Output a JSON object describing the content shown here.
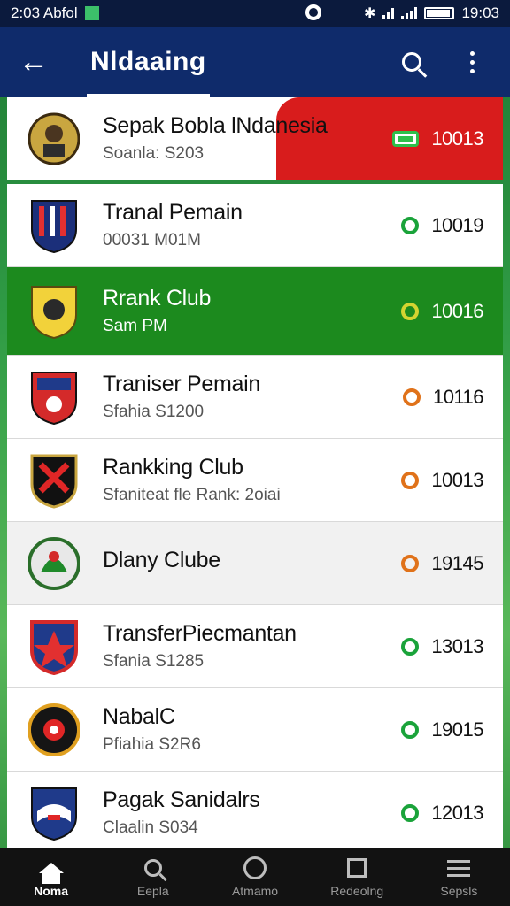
{
  "status_bar": {
    "left_text": "2:03 Abfol",
    "time": "19:03"
  },
  "app_bar": {
    "title": "Nldaaing"
  },
  "list": [
    {
      "title": "Sepak Bobla lNdanesia",
      "subtitle": "Soanla: S203",
      "score": "10013",
      "icon": "rect-badge",
      "style": "first",
      "crest": "portrait-crest"
    },
    {
      "title": "Tranal Pemain",
      "subtitle": "00031 M01M",
      "score": "10019",
      "icon": "green-badge",
      "style": "normal",
      "crest": "red-striped-crest"
    },
    {
      "title": "Rrank Club",
      "subtitle": "Sam PM",
      "score": "10016",
      "icon": "yellow-badge",
      "style": "highlight",
      "crest": "gold-lion-crest"
    },
    {
      "title": "Traniser Pemain",
      "subtitle": "Sfahia S1200",
      "score": "10116",
      "icon": "orange-badge",
      "style": "normal",
      "crest": "blue-red-crest"
    },
    {
      "title": "Rankking Club",
      "subtitle": "Sfaniteat fle Rank: 2oiai",
      "score": "10013",
      "icon": "orange-badge",
      "style": "normal",
      "crest": "black-red-crest"
    },
    {
      "title": "Dlany Clube",
      "subtitle": "",
      "score": "19145",
      "icon": "orange-badge",
      "style": "light",
      "crest": "green-round-crest"
    },
    {
      "title": "TransferPiecmantan",
      "subtitle": "Sfania S1285",
      "score": "13013",
      "icon": "green-badge",
      "style": "normal",
      "crest": "red-blue-crest"
    },
    {
      "title": "NabalC",
      "subtitle": "Pfiahia S2R6",
      "score": "19015",
      "icon": "green-badge",
      "style": "normal",
      "crest": "dark-round-crest"
    },
    {
      "title": "Pagak Sanidalrs",
      "subtitle": "Claalin S034",
      "score": "12013",
      "icon": "green-badge",
      "style": "normal",
      "crest": "blue-shield-crest"
    }
  ],
  "bottom_nav": [
    {
      "label": "Noma",
      "active": true
    },
    {
      "label": "Eepla",
      "active": false
    },
    {
      "label": "Atmamo",
      "active": false
    },
    {
      "label": "Redeolng",
      "active": false
    },
    {
      "label": "Sepsls",
      "active": false
    }
  ],
  "colors": {
    "app_bar": "#0f2b6b",
    "highlight_row": "#1c8a1e",
    "red_block": "#d81c1c",
    "status_bar": "#0b1a3d"
  }
}
